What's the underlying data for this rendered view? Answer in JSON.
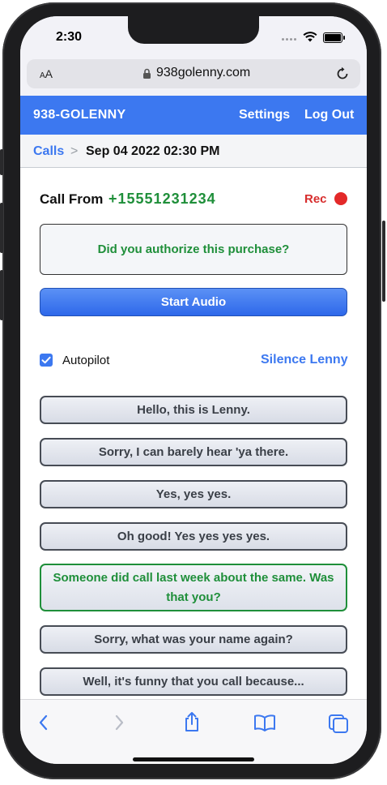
{
  "status_bar": {
    "time": "2:30"
  },
  "browser": {
    "aa_big": "A",
    "aa_small": "A",
    "domain": "938golenny.com"
  },
  "app": {
    "brand": "938-GOLENNY",
    "nav": {
      "settings": "Settings",
      "logout": "Log Out"
    }
  },
  "breadcrumb": {
    "parent": "Calls",
    "separator": ">",
    "current": "Sep 04 2022 02:30 PM"
  },
  "call": {
    "from_label": "Call From",
    "number": "+15551231234",
    "rec_label": "Rec",
    "prompt": "Did you authorize this purchase?",
    "start_audio": "Start Audio",
    "autopilot_label": "Autopilot",
    "autopilot_checked": true,
    "silence_label": "Silence Lenny"
  },
  "replies": [
    {
      "text": "Hello, this is Lenny."
    },
    {
      "text": "Sorry, I can barely hear 'ya there."
    },
    {
      "text": "Yes, yes yes."
    },
    {
      "text": "Oh good! Yes yes yes yes."
    },
    {
      "text": "Someone did call last week about the same. Was that you?",
      "active": true
    },
    {
      "text": "Sorry, what was your name again?"
    },
    {
      "text": "Well, it's funny that you call because..."
    }
  ],
  "colors": {
    "accent": "#3c78f0",
    "green": "#1f8f3a",
    "record": "#e32929"
  }
}
